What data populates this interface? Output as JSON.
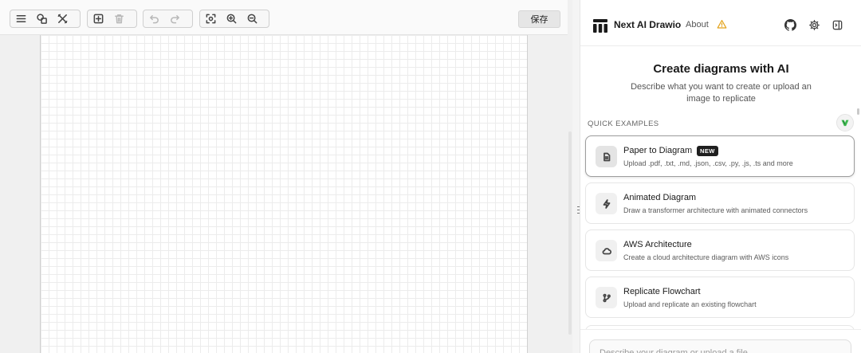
{
  "toolbar": {
    "save_label": "保存"
  },
  "header": {
    "app_title": "Next AI Drawio",
    "about_label": "About"
  },
  "hero": {
    "title": "Create diagrams with AI",
    "description": "Describe what you want to create or upload an image to replicate"
  },
  "examples": {
    "section_label": "QUICK EXAMPLES",
    "items": [
      {
        "title": "Paper to Diagram",
        "badge": "NEW",
        "description": "Upload .pdf, .txt, .md, .json, .csv, .py, .js, .ts and more",
        "icon": "file-text-icon"
      },
      {
        "title": "Animated Diagram",
        "description": "Draw a transformer architecture with animated connectors",
        "icon": "zap-icon"
      },
      {
        "title": "AWS Architecture",
        "description": "Create a cloud architecture diagram with AWS icons",
        "icon": "cloud-icon"
      },
      {
        "title": "Replicate Flowchart",
        "description": "Upload and replicate an existing flowchart",
        "icon": "git-branch-icon"
      }
    ]
  },
  "composer": {
    "placeholder": "Describe your diagram or upload a file..."
  },
  "colors": {
    "warning": "#e3a21a",
    "accent_green": "#3fb950",
    "badge_bg": "#1f1f1f"
  }
}
